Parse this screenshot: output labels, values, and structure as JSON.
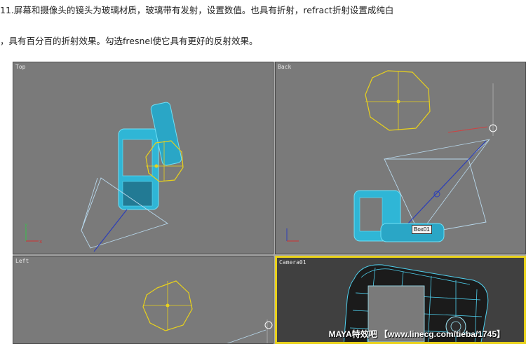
{
  "caption": {
    "line1": "11.屏幕和摄像头的镜头为玻璃材质，玻璃带有发射，设置数值。也具有折射，refract折射设置成纯白",
    "line2": "，具有百分百的折射效果。勾选fresnel使它具有更好的反射效果。"
  },
  "viewports": {
    "top": {
      "label": "Top"
    },
    "back": {
      "label": "Back",
      "object_tag": "Box01"
    },
    "left": {
      "label": "Left"
    },
    "camera": {
      "label": "Camera01"
    }
  },
  "watermark": "MAYA特效吧 【www.linecg.com/tieba/1745】",
  "colors": {
    "viewport_bg": "#7a7a7a",
    "camera_bg": "#404040",
    "active_border": "#e8d11c",
    "mesh": "#35c8e8",
    "light": "#e8d11c",
    "frustum": "#b8d8ec"
  }
}
